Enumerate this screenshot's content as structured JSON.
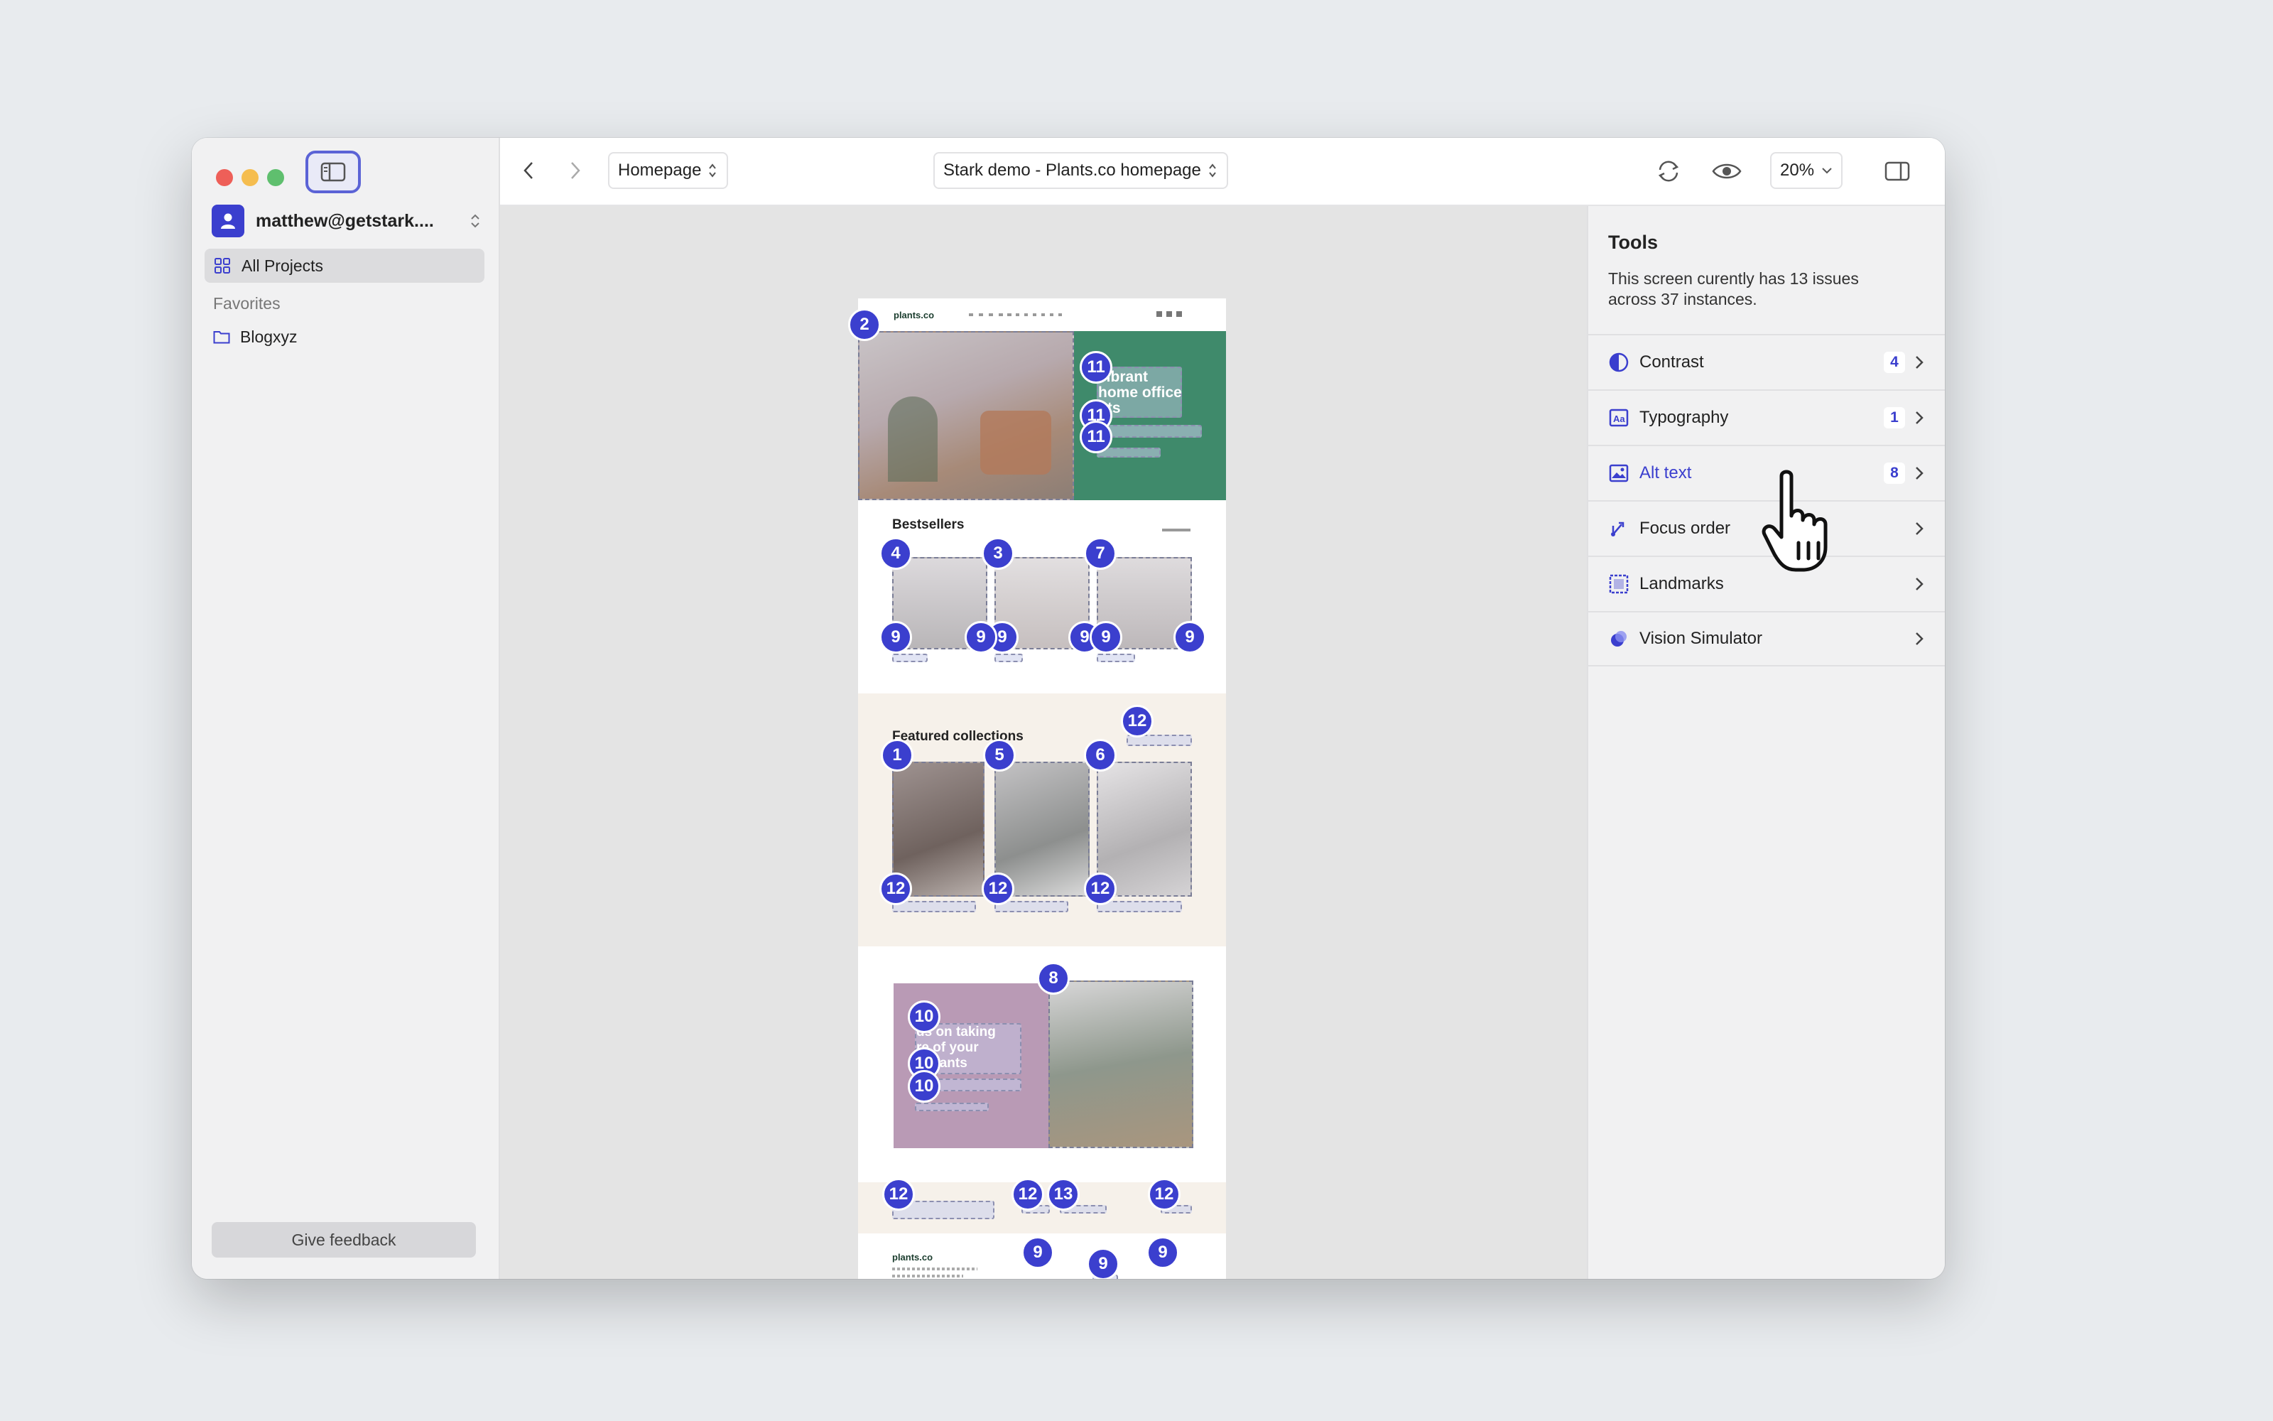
{
  "sidebar": {
    "account_name": "matthew@getstark....",
    "all_projects_label": "All Projects",
    "favorites_label": "Favorites",
    "items": [
      {
        "label": "Blogxyz",
        "icon": "folder-icon"
      }
    ],
    "feedback_label": "Give feedback"
  },
  "toolbar": {
    "page_select": "Homepage",
    "project_select": "Stark demo - Plants.co homepage",
    "zoom": "20%"
  },
  "canvas_page": {
    "logo": "plants.co",
    "hero_text": [
      "vibrant",
      "home office",
      "nts"
    ],
    "bestsellers_title": "Bestsellers",
    "featured_title": "Featured collections",
    "care_text": [
      "ds on taking",
      "re of your",
      "e plants"
    ],
    "footer_logo": "plants.co",
    "badges": [
      "2",
      "11",
      "11",
      "11",
      "4",
      "3",
      "7",
      "9",
      "9",
      "9",
      "9",
      "9",
      "9",
      "12",
      "1",
      "5",
      "6",
      "12",
      "12",
      "12",
      "8",
      "10",
      "10",
      "10",
      "12",
      "12",
      "13",
      "12",
      "9",
      "9",
      "9"
    ]
  },
  "panel": {
    "title": "Tools",
    "description": "This screen curently has 13 issues across 37 instances.",
    "tools": [
      {
        "label": "Contrast",
        "count": "4",
        "icon": "contrast-icon",
        "active": false
      },
      {
        "label": "Typography",
        "count": "1",
        "icon": "typography-icon",
        "active": false
      },
      {
        "label": "Alt text",
        "count": "8",
        "icon": "alt-text-icon",
        "active": true
      },
      {
        "label": "Focus order",
        "count": "",
        "icon": "focus-order-icon",
        "active": false
      },
      {
        "label": "Landmarks",
        "count": "",
        "icon": "landmarks-icon",
        "active": false
      },
      {
        "label": "Vision Simulator",
        "count": "",
        "icon": "vision-simulator-icon",
        "active": false
      }
    ]
  },
  "colors": {
    "accent": "#3b3fce",
    "hero_green": "#3f8a6b",
    "care_purple": "#b99ab5",
    "featured_bg": "#f6f1ea"
  }
}
